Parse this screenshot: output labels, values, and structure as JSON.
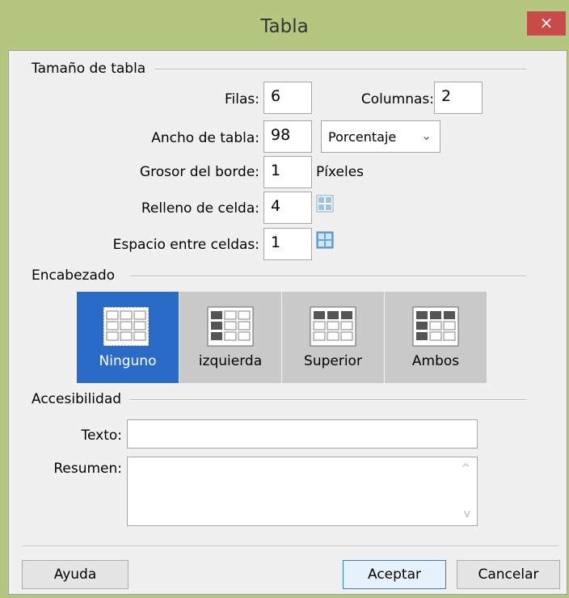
{
  "window": {
    "title": "Tabla",
    "close_label": "×"
  },
  "table_size": {
    "group_label": "Tamaño de tabla",
    "rows_label": "Filas:",
    "rows_value": "6",
    "columns_label": "Columnas:",
    "columns_value": "2",
    "width_label": "Ancho de tabla:",
    "width_value": "98",
    "width_unit": "Porcentaje",
    "border_label": "Grosor del borde:",
    "border_value": "1",
    "border_unit": "Píxeles",
    "padding_label": "Relleno de celda:",
    "padding_value": "4",
    "spacing_label": "Espacio entre celdas:",
    "spacing_value": "1"
  },
  "header": {
    "group_label": "Encabezado",
    "options": [
      {
        "label": "Ninguno",
        "selected": true
      },
      {
        "label": "izquierda",
        "selected": false
      },
      {
        "label": "Superior",
        "selected": false
      },
      {
        "label": "Ambos",
        "selected": false
      }
    ]
  },
  "accessibility": {
    "group_label": "Accesibilidad",
    "text_label": "Texto:",
    "text_value": "",
    "summary_label": "Resumen:",
    "summary_value": ""
  },
  "buttons": {
    "help": "Ayuda",
    "ok": "Aceptar",
    "cancel": "Cancelar"
  },
  "colors": {
    "titlebar": "#b5c77f",
    "close": "#c84b49",
    "selected": "#2a6bc8",
    "option_bg": "#c9c9c9"
  }
}
